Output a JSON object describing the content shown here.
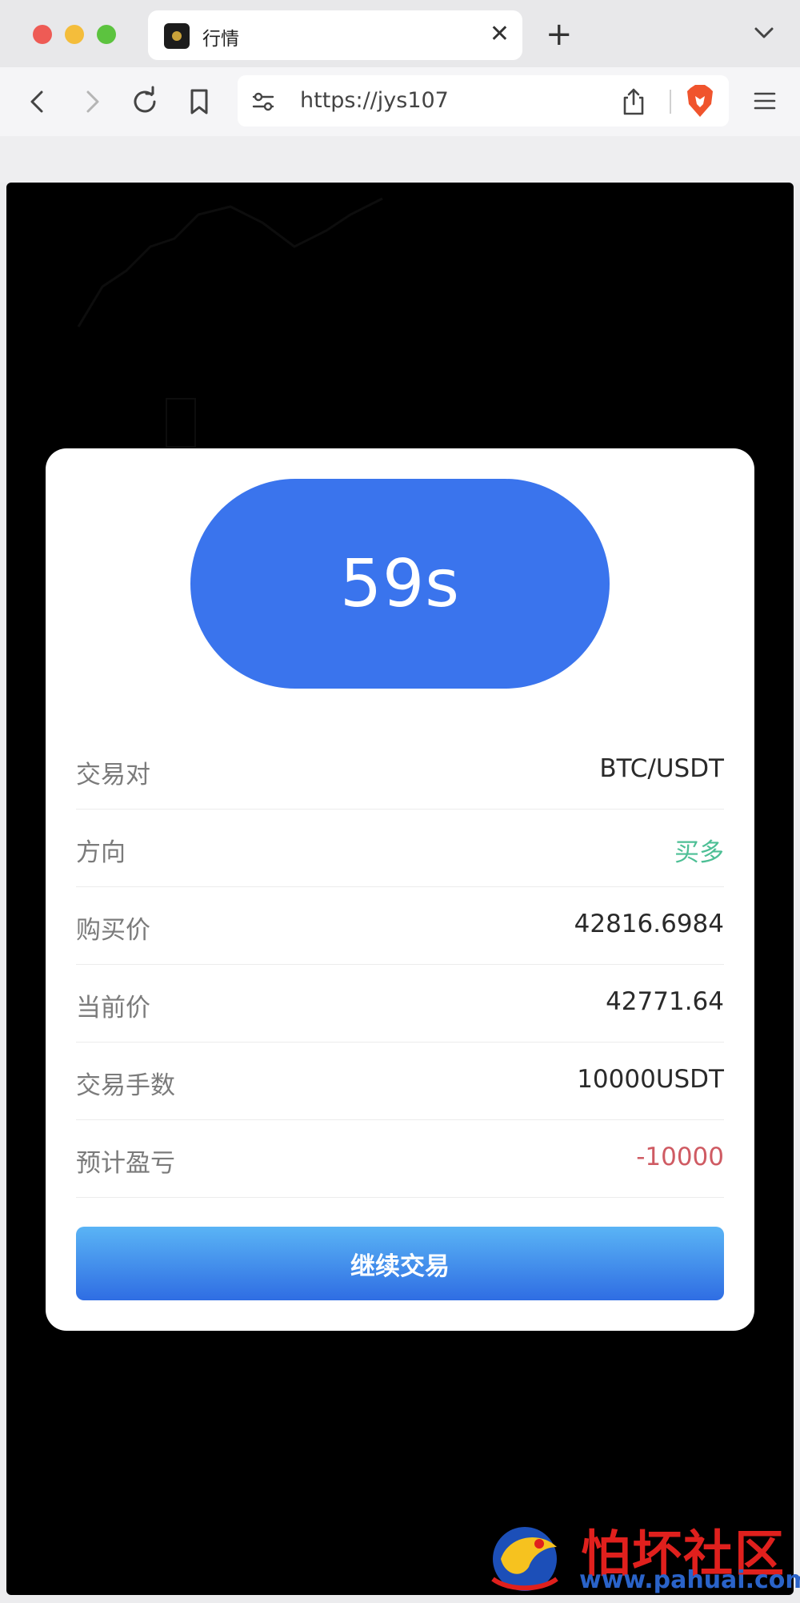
{
  "browser": {
    "tab_title": "行情",
    "tab_close": "✕",
    "new_tab": "+",
    "url": "https://jys107"
  },
  "modal": {
    "countdown": "59s",
    "rows": [
      {
        "label": "交易对",
        "value": "BTC/USDT"
      },
      {
        "label": "方向",
        "value": "买多"
      },
      {
        "label": "购买价",
        "value": "42816.6984"
      },
      {
        "label": "当前价",
        "value": "42771.64"
      },
      {
        "label": "交易手数",
        "value": "10000USDT"
      },
      {
        "label": "预计盈亏",
        "value": "-10000"
      }
    ],
    "continue_label": "继续交易"
  },
  "colors": {
    "timer_blue": "#3a74ed",
    "direction_green": "#4dbf95",
    "pnl_red": "#cf5b63"
  },
  "watermark": {
    "title": "怕坏社区",
    "url": "www.pahuai.com"
  }
}
